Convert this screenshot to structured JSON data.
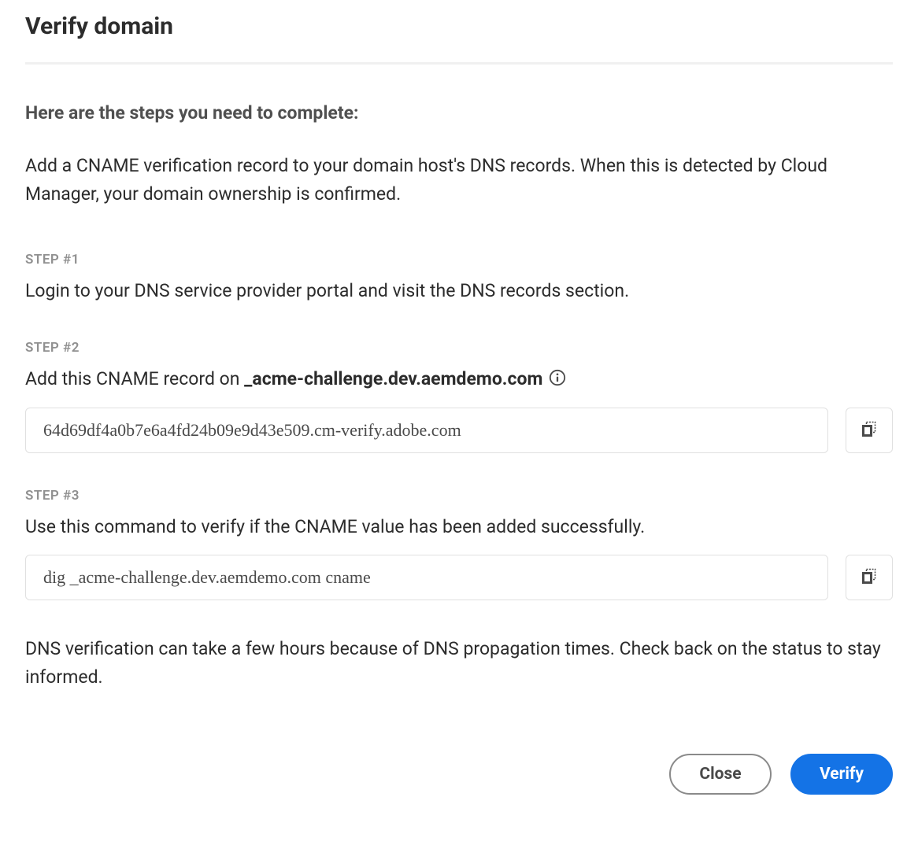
{
  "dialog": {
    "title": "Verify domain",
    "subheading": "Here are the steps you need to complete:",
    "intro": "Add a CNAME verification record to your domain host's DNS records. When this is detected by Cloud Manager, your domain ownership is confirmed.",
    "step1": {
      "label": "STEP #1",
      "text": "Login to your DNS service provider portal and visit the DNS records section."
    },
    "step2": {
      "label": "STEP #2",
      "text_prefix": "Add this CNAME record on ",
      "text_bold": "_acme-challenge.dev.aemdemo.com",
      "record_value": "64d69df4a0b7e6a4fd24b09e9d43e509.cm-verify.adobe.com"
    },
    "step3": {
      "label": "STEP #3",
      "text": "Use this command to verify if the CNAME value has been added successfully.",
      "command_value": "dig _acme-challenge.dev.aemdemo.com cname"
    },
    "footer_note": "DNS verification can take a few hours because of DNS propagation times. Check back on the status to stay informed.",
    "buttons": {
      "close": "Close",
      "verify": "Verify"
    }
  }
}
